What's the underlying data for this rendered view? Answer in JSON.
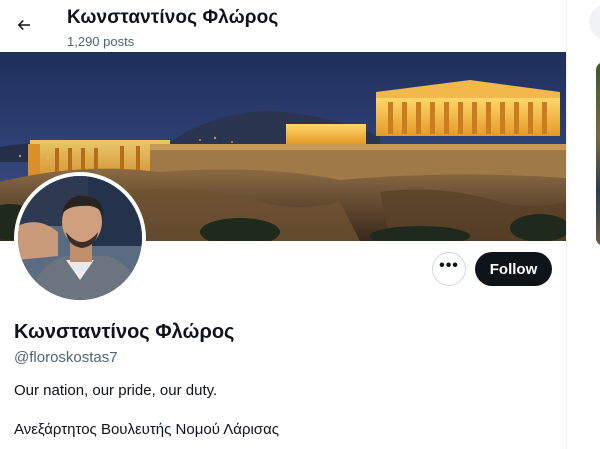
{
  "header": {
    "title": "Κωνσταντίνος Φλώρος",
    "post_count": "1,290 posts"
  },
  "icons": {
    "back": "arrow-left-icon",
    "more": "more-horizontal-icon"
  },
  "profile": {
    "display_name": "Κωνσταντίνος Φλώρος",
    "handle": "@floroskostas7",
    "bio_line_1": "Our nation, our pride, our duty.",
    "bio_line_2": "Ανεξάρτητος Βουλευτής Νομού Λάρισας"
  },
  "actions": {
    "more_label": "•••",
    "follow_label": "Follow"
  },
  "colors": {
    "text_primary": "#0f1419",
    "text_secondary": "#536471",
    "follow_bg": "#0f1419",
    "border": "#cfd9de"
  }
}
